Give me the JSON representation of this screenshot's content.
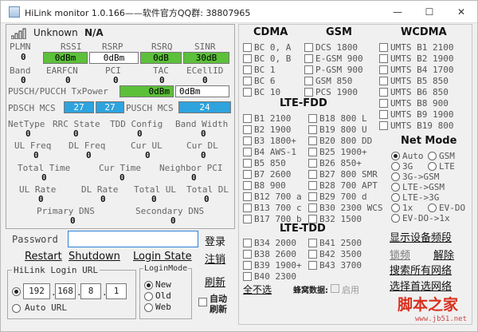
{
  "window": {
    "title": "HiLink monitor 1.0.166——软件官方QQ群: 38807965",
    "min": "—",
    "max": "☐",
    "close": "✕"
  },
  "left": {
    "carrier": "Unknown",
    "na": "N/A",
    "signal_labels": [
      "PLMN",
      "RSSI",
      "RSRP",
      "RSRQ",
      "SINR"
    ],
    "plmn": "0",
    "rssi": "0dBm",
    "rsrp": "0dBm",
    "rsrq": "0dB",
    "sinr": "30dB",
    "cell_labels": [
      "Band",
      "EARFCN",
      "PCI",
      "TAC",
      "ECellID"
    ],
    "band": "0",
    "earfcn": "0",
    "pci": "0",
    "tac": "0",
    "ecellid": "0",
    "pusch_label": "PUSCH/PUCCH TxPower",
    "pusch_val1": "0dBm",
    "pusch_val2": "0dBm",
    "pdsch_label": "PDSCH MCS",
    "pdsch_v1": "27",
    "pdsch_v2": "27",
    "pusch_mcs_label": "PUSCH MCS",
    "pusch_mcs_v": "24",
    "r1": [
      "NetType",
      "RRC State",
      "TDD Config",
      "Band Width"
    ],
    "r1v": [
      "0",
      "0",
      "0",
      "0"
    ],
    "r2": [
      "UL Freq",
      "DL Freq",
      "Cur UL",
      "Cur DL"
    ],
    "r2v": [
      "0",
      "0",
      "0",
      "0"
    ],
    "r3": [
      "Total Time",
      "Cur Time",
      "Neighbor PCI"
    ],
    "r3v": [
      "0",
      "0",
      "0"
    ],
    "r4": [
      "UL Rate",
      "DL Rate",
      "Total UL",
      "Total DL"
    ],
    "r4v": [
      "0",
      "0",
      "0",
      "0"
    ],
    "r5": [
      "Primary DNS",
      "Secondary DNS"
    ],
    "r5v": [
      "0",
      "0"
    ],
    "password_label": "Password",
    "password_value": "",
    "login_btn": "登录",
    "restart": "Restart",
    "shutdown": "Shutdown",
    "login_state": "Login State",
    "logout": "注销",
    "url_group": "HiLink Login URL",
    "ip": [
      "192",
      "168",
      "8",
      "1"
    ],
    "auto_url": "Auto URL",
    "login_mode": "LoginMode",
    "modes": [
      "New",
      "Old",
      "Web"
    ],
    "refresh": "刷新",
    "auto_refresh": "自动\n刷新"
  },
  "right": {
    "cdma_title": "CDMA",
    "gsm_title": "GSM",
    "wcdma_title": "WCDMA",
    "cdma": [
      "BC 0, A",
      "BC 0, B",
      "BC 1",
      "BC 6",
      "BC 10"
    ],
    "gsm": [
      "DCS 1800",
      "E-GSM 900",
      "P-GSM 900",
      "GSM 850",
      "PCS 1900"
    ],
    "wcdma": [
      "UMTS B1 2100",
      "UMTS B2 1900",
      "UMTS B4 1700",
      "UMTS B5 850",
      "UMTS B6 850",
      "UMTS B8 900",
      "UMTS B9 1900",
      "UMTS B19 800"
    ],
    "fdd_title": "LTE-FDD",
    "fdd_a": [
      "B1 2100",
      "B2 1900",
      "B3 1800+",
      "B4 AWS-1",
      "B5 850",
      "B7 2600",
      "B8 900",
      "B12 700 a",
      "B13 700 c",
      "B17 700 b"
    ],
    "fdd_b": [
      "B18 800 L",
      "B19 800 U",
      "B20 800 DD",
      "B25 1900+",
      "B26 850+",
      "B27 800 SMR",
      "B28 700 APT",
      "B29 700 d",
      "B30 2300 WCS",
      "B32 1500"
    ],
    "netmode_title": "Net Mode",
    "netmode": [
      "Auto",
      "GSM",
      "3G",
      "LTE",
      "3G->GSM",
      "LTE->GSM",
      "LTE->3G",
      "1x",
      "EV-DO",
      "EV-DO->1x"
    ],
    "tdd_title": "LTE-TDD",
    "tdd_a": [
      "B34 2000",
      "B38 2600",
      "B39 1900+",
      "B40 2300"
    ],
    "tdd_b": [
      "B41 2500",
      "B42 3500",
      "B43 3700"
    ],
    "select_all": "全不选",
    "honeycomb": "蜂窝数据:",
    "enable": "启用",
    "actions": [
      "显示设备频段",
      "锁频",
      "解除",
      "搜索所有网络",
      "选择首选网络"
    ],
    "watermark": "脚本之家",
    "watermark_url": "www.jb51.net"
  }
}
